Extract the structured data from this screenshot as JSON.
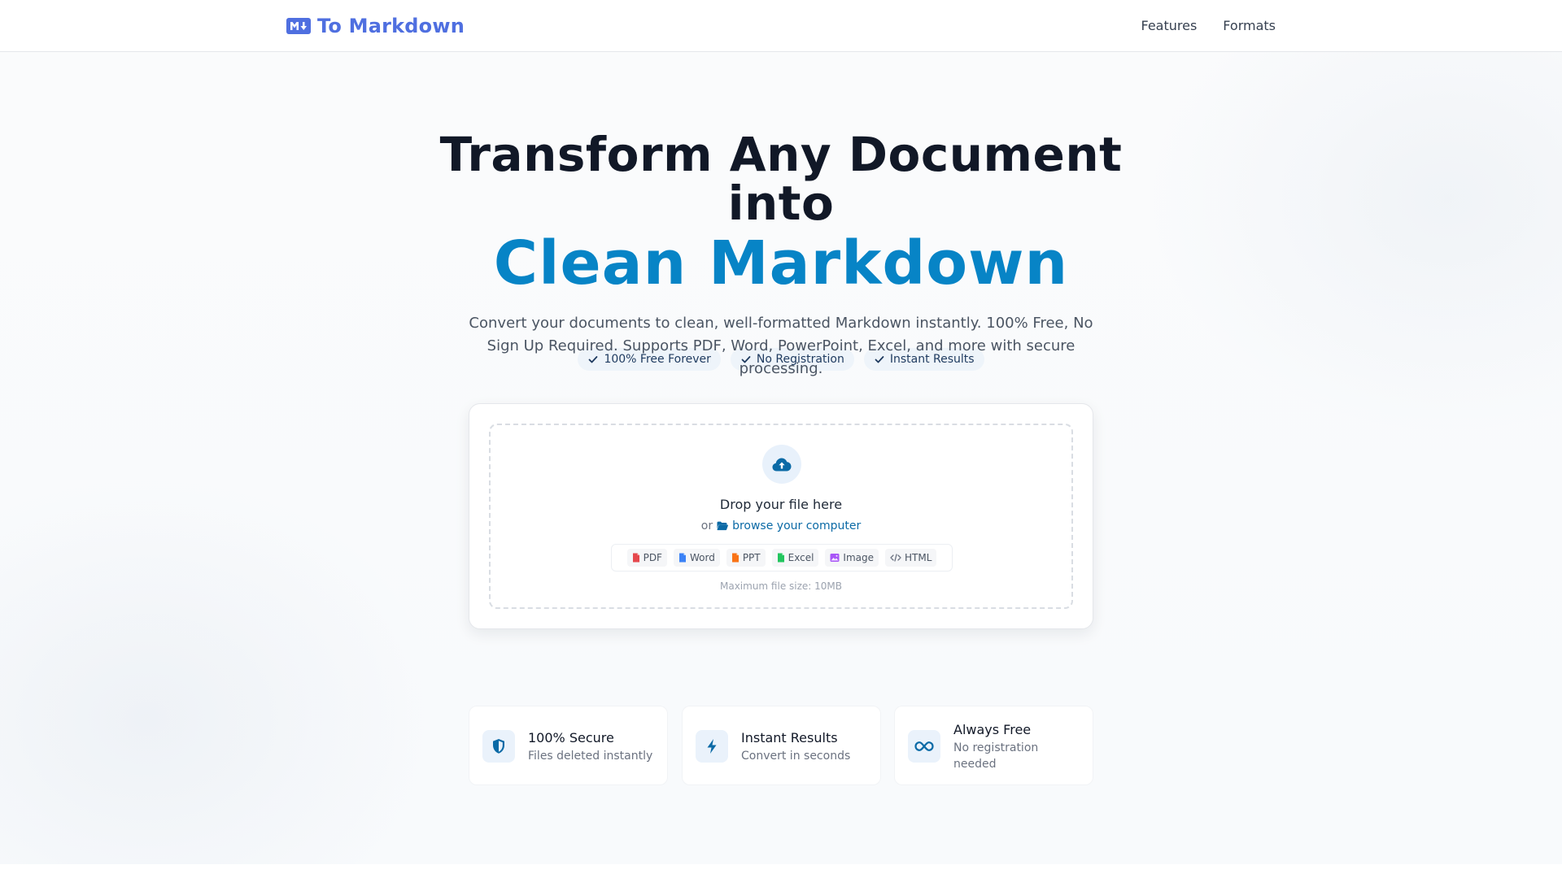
{
  "header": {
    "logo_text": "To Markdown",
    "logo_icon": "markdown-icon",
    "nav": [
      {
        "label": "Features"
      },
      {
        "label": "Formats"
      }
    ]
  },
  "hero": {
    "title_line1": "Transform Any Document",
    "title_line2": "into",
    "title_accent": "Clean Markdown",
    "subtitle": "Convert your documents to clean, well-formatted Markdown instantly. 100% Free, No Sign Up Required. Supports PDF, Word, PowerPoint, Excel, and more with secure processing.",
    "badges": [
      {
        "label": "100% Free Forever",
        "icon": "check-icon"
      },
      {
        "label": "No Registration",
        "icon": "check-icon"
      },
      {
        "label": "Instant Results",
        "icon": "check-icon"
      }
    ]
  },
  "upload": {
    "drop_text": "Drop your file here",
    "or_text": "or",
    "browse_text": "browse your computer",
    "formats": [
      {
        "label": "PDF",
        "color": "#e5484d"
      },
      {
        "label": "Word",
        "color": "#3b82f6"
      },
      {
        "label": "PPT",
        "color": "#f97316"
      },
      {
        "label": "Excel",
        "color": "#22c55e"
      },
      {
        "label": "Image",
        "color": "#a855f7"
      },
      {
        "label": "HTML",
        "color": "#6b7280"
      }
    ],
    "max_size": "Maximum file size: 10MB"
  },
  "features": [
    {
      "title": "100% Secure",
      "subtitle": "Files deleted instantly",
      "icon": "shield-icon"
    },
    {
      "title": "Instant Results",
      "subtitle": "Convert in seconds",
      "icon": "bolt-icon"
    },
    {
      "title": "Always Free",
      "subtitle": "No registration needed",
      "icon": "infinity-icon"
    }
  ],
  "colors": {
    "brand": "#4f6fe0",
    "accent": "#0784c6",
    "link": "#0b6aa6",
    "text": "#111827",
    "muted": "#6b7280"
  }
}
